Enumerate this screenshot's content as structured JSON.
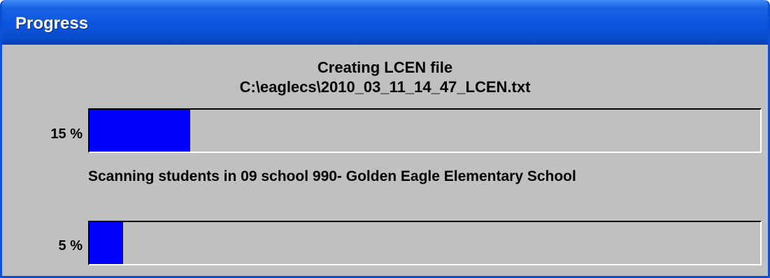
{
  "window": {
    "title": "Progress"
  },
  "task": {
    "heading": "Creating LCEN file",
    "file_path": "C:\\eaglecs\\2010_03_11_14_47_LCEN.txt",
    "status": "Scanning students in 09 school 990- Golden Eagle Elementary School"
  },
  "progress": [
    {
      "label": "15 %",
      "value": 0.15
    },
    {
      "label": "5 %",
      "value": 0.05
    }
  ],
  "colors": {
    "titlebar": "#0a4ccc",
    "background": "#c0c0c0",
    "bar_fill": "#0000ff"
  }
}
